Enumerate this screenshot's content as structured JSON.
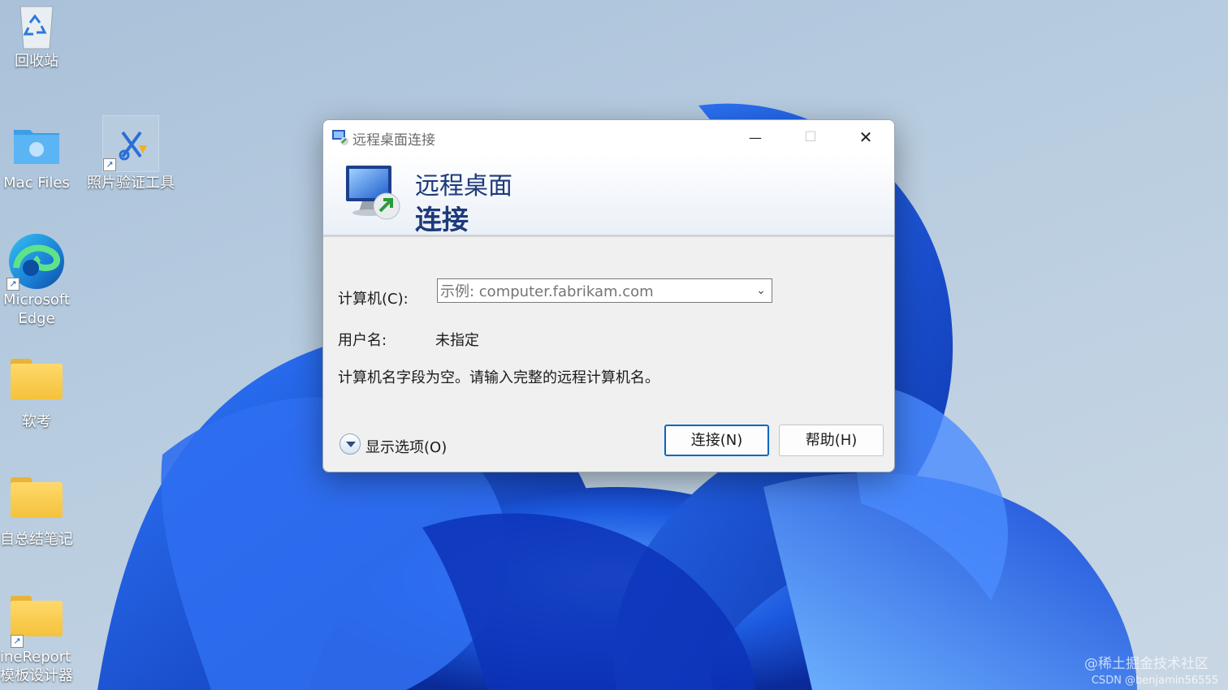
{
  "desktop": {
    "icons": [
      {
        "label": "回收站"
      },
      {
        "label": "Mac Files"
      },
      {
        "label": "照片验证工具"
      },
      {
        "label": "Microsoft Edge"
      },
      {
        "label": "软考"
      },
      {
        "label": "自总结笔记"
      },
      {
        "label": "ineReport模板设计器"
      }
    ]
  },
  "dialog": {
    "title": "远程桌面连接",
    "window_controls": {
      "minimize": "—",
      "maximize": "☐",
      "close": "✕"
    },
    "banner": {
      "line1": "远程桌面",
      "line2": "连接"
    },
    "computer_label": "计算机(C):",
    "computer_placeholder": "示例: computer.fabrikam.com",
    "computer_value": "",
    "username_label": "用户名:",
    "username_value": "未指定",
    "message": "计算机名字段为空。请输入完整的远程计算机名。",
    "show_options": "显示选项(O)",
    "connect_button": "连接(N)",
    "help_button": "帮助(H)"
  },
  "watermark": {
    "line1": "@稀土掘金技术社区",
    "line2": "CSDN @benjamin56555"
  },
  "colors": {
    "banner_text": "#1d3a7a",
    "accent": "#0067c0",
    "wallpaper_blue": "#1b4fd8"
  }
}
